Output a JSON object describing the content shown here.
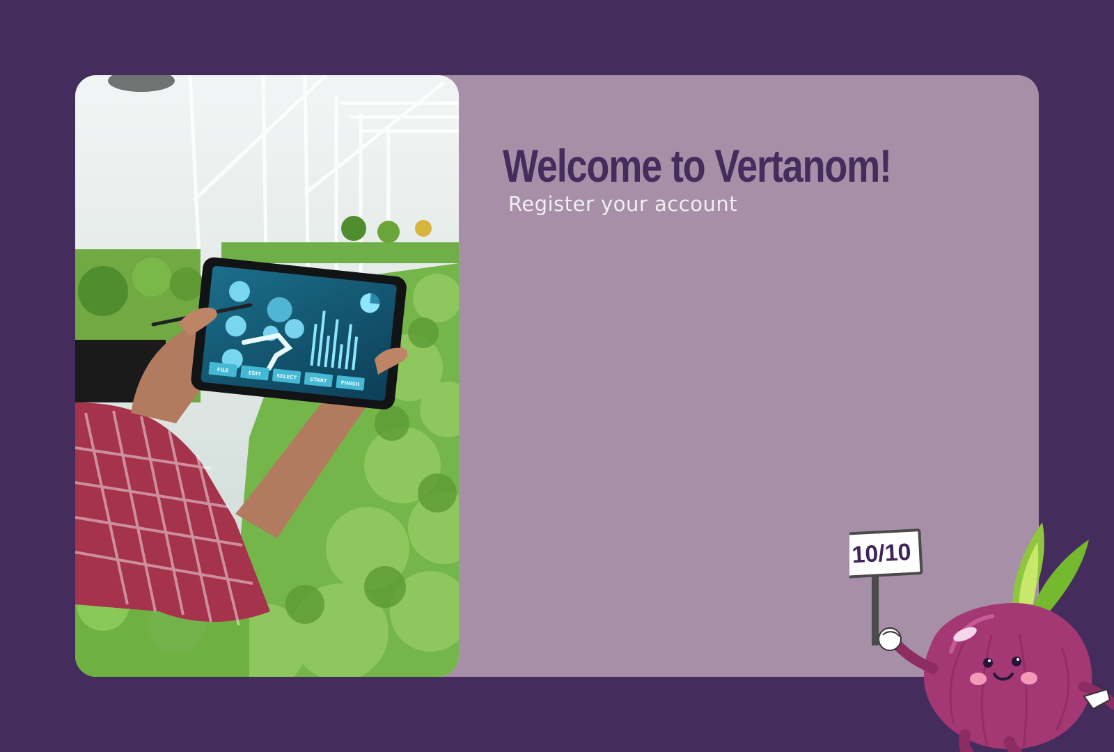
{
  "welcome": {
    "title": "Welcome to Vertanom!",
    "subtitle": "Register your account"
  },
  "hero_image": {
    "tablet_buttons": [
      "FILE",
      "EDIT",
      "SELECT",
      "START",
      "FINISH"
    ]
  },
  "mascot": {
    "sign_text": "10/10"
  },
  "colors": {
    "background": "#442d5c",
    "card": "#a78fa8",
    "title": "#442d5c",
    "subtitle": "#f3eef3",
    "onion": "#a33875"
  }
}
